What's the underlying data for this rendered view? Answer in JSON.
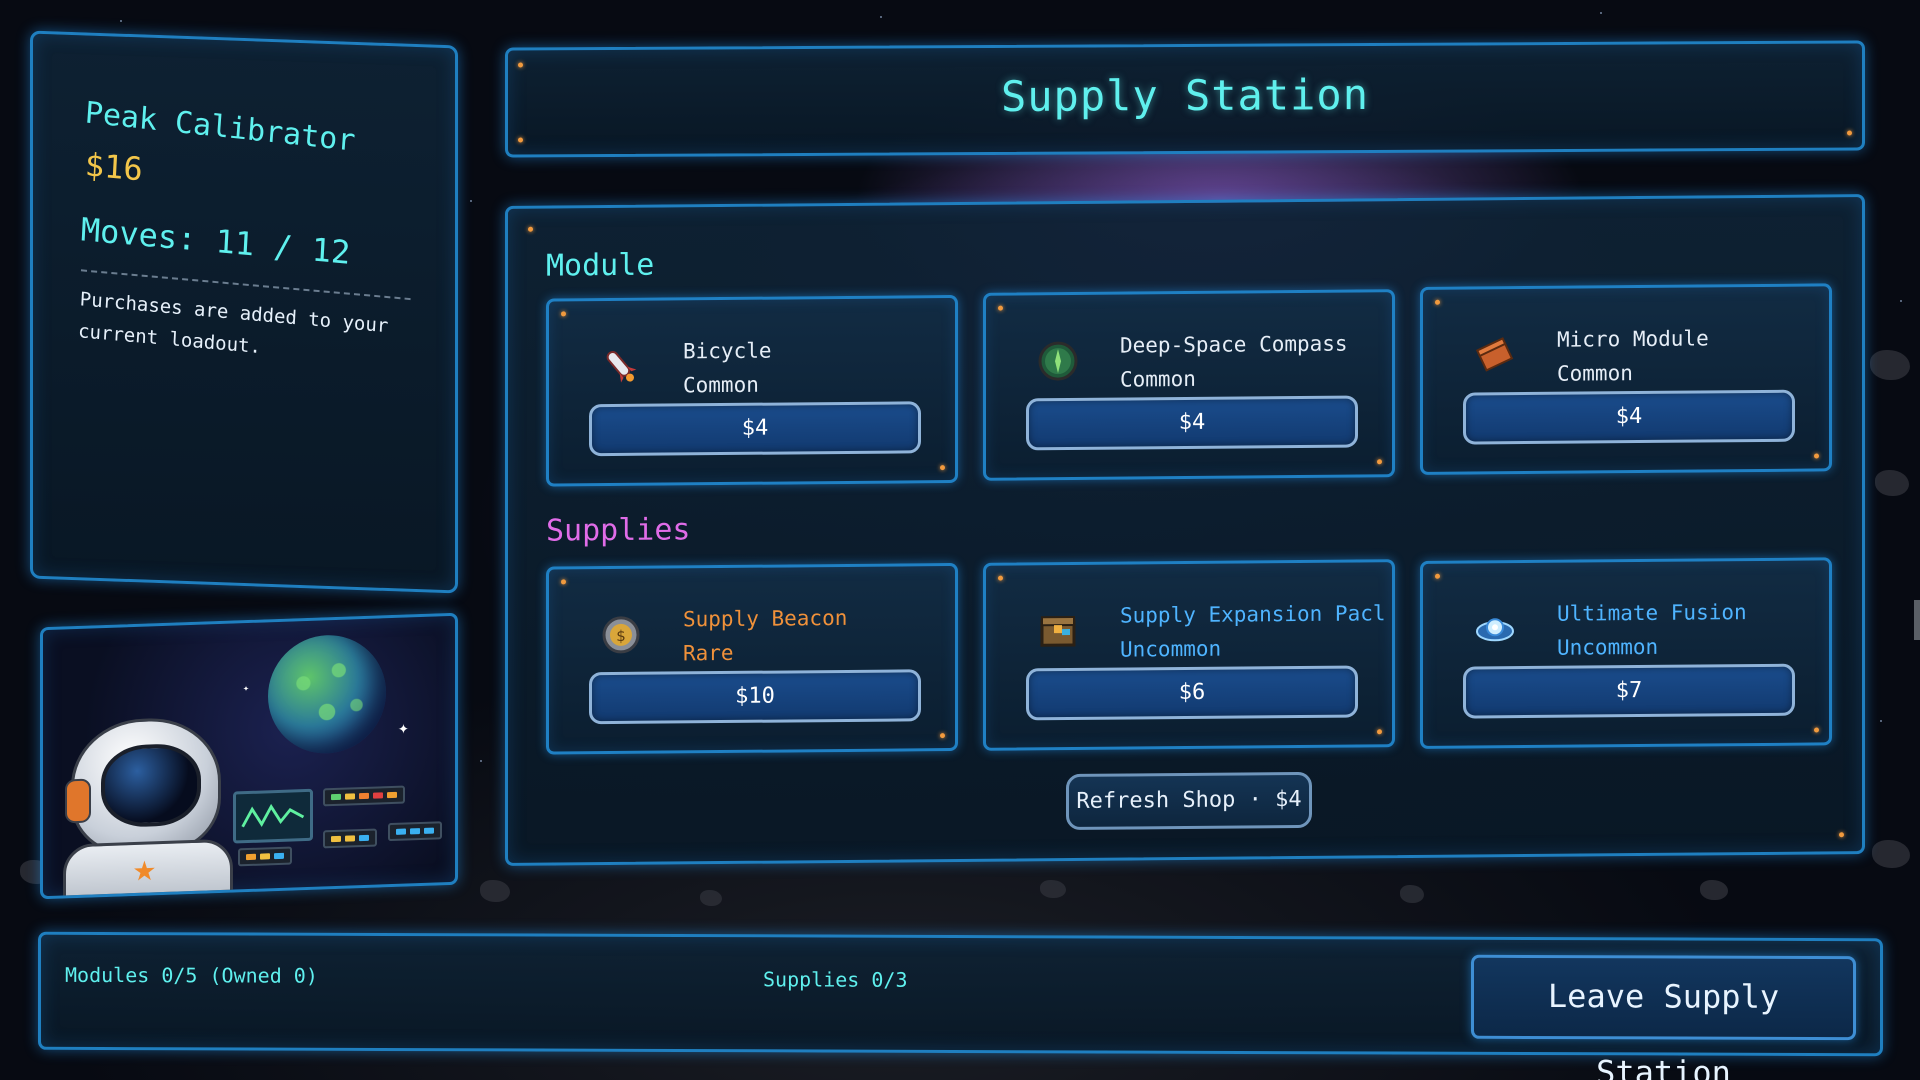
{
  "info": {
    "item_name": "Peak Calibrator",
    "money": "$16",
    "moves": "Moves: 11 / 12",
    "note": "Purchases are added to your current loadout."
  },
  "header": {
    "title": "Supply Station"
  },
  "sections": {
    "module_label": "Module",
    "supplies_label": "Supplies"
  },
  "modules": [
    {
      "name": "Bicycle",
      "rarity": "Common",
      "price": "$4",
      "icon": "rocket-icon"
    },
    {
      "name": "Deep-Space Compass",
      "rarity": "Common",
      "price": "$4",
      "icon": "compass-icon"
    },
    {
      "name": "Micro Module",
      "rarity": "Common",
      "price": "$4",
      "icon": "brick-icon"
    }
  ],
  "supplies": [
    {
      "name": "Supply Beacon",
      "rarity": "Rare",
      "price": "$10",
      "icon": "coin-icon"
    },
    {
      "name": "Supply Expansion Pacl",
      "rarity": "Uncommon",
      "price": "$6",
      "icon": "crate-icon"
    },
    {
      "name": "Ultimate Fusion",
      "rarity": "Uncommon",
      "price": "$7",
      "icon": "fusion-core-icon"
    }
  ],
  "refresh": {
    "label": "Refresh Shop · $4"
  },
  "footer": {
    "modules_status": "Modules 0/5 (Owned 0)",
    "supplies_status": "Supplies 0/3",
    "leave_label": "Leave Supply Station"
  },
  "colors": {
    "accent_cyan": "#5ff0ee",
    "money_gold": "#f3c64a",
    "supplies_magenta": "#e06ce8",
    "rarity_common": "#e6eef7",
    "rarity_rare": "#f0913a",
    "rarity_uncommon": "#4fb4ff",
    "panel_border": "#1f7fc0"
  }
}
